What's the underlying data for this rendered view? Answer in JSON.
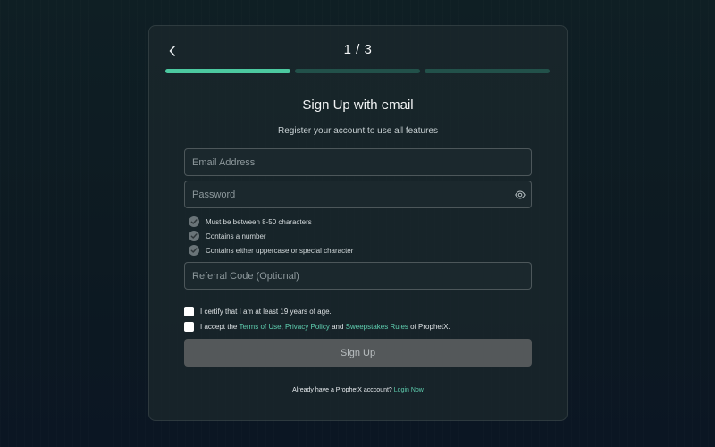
{
  "header": {
    "step": "1 / 3",
    "progress": {
      "total_steps": 3,
      "current_step": 1
    }
  },
  "title": "Sign Up with email",
  "subtitle": "Register your account to use all features",
  "form": {
    "email_placeholder": "Email Address",
    "email_value": "",
    "password_placeholder": "Password",
    "password_value": "",
    "referral_placeholder": "Referral Code (Optional)",
    "referral_value": ""
  },
  "password_rules": [
    "Must be between 8-50 characters",
    "Contains a number",
    "Contains either uppercase or special character"
  ],
  "agreements": {
    "age": "I certify that I am at least 19 years of age.",
    "terms_prefix": "I accept the",
    "terms_link": "Terms of Use",
    "terms_sep": ",",
    "privacy_link": "Privacy Policy",
    "and": "and",
    "sweepstakes_link": "Sweepstakes Rules",
    "terms_suffix": "of ProphetX."
  },
  "signup_button": "Sign Up",
  "footer": {
    "text": "Already have a ProphetX acccount?",
    "login_link": "Login Now"
  },
  "colors": {
    "accent": "#4cc9a0",
    "progress_inactive": "#22514a",
    "link": "#5fcfb0",
    "button_disabled": "#54585a"
  },
  "icons": [
    "chevron-left-icon",
    "eye-icon",
    "check-circle-icon"
  ]
}
